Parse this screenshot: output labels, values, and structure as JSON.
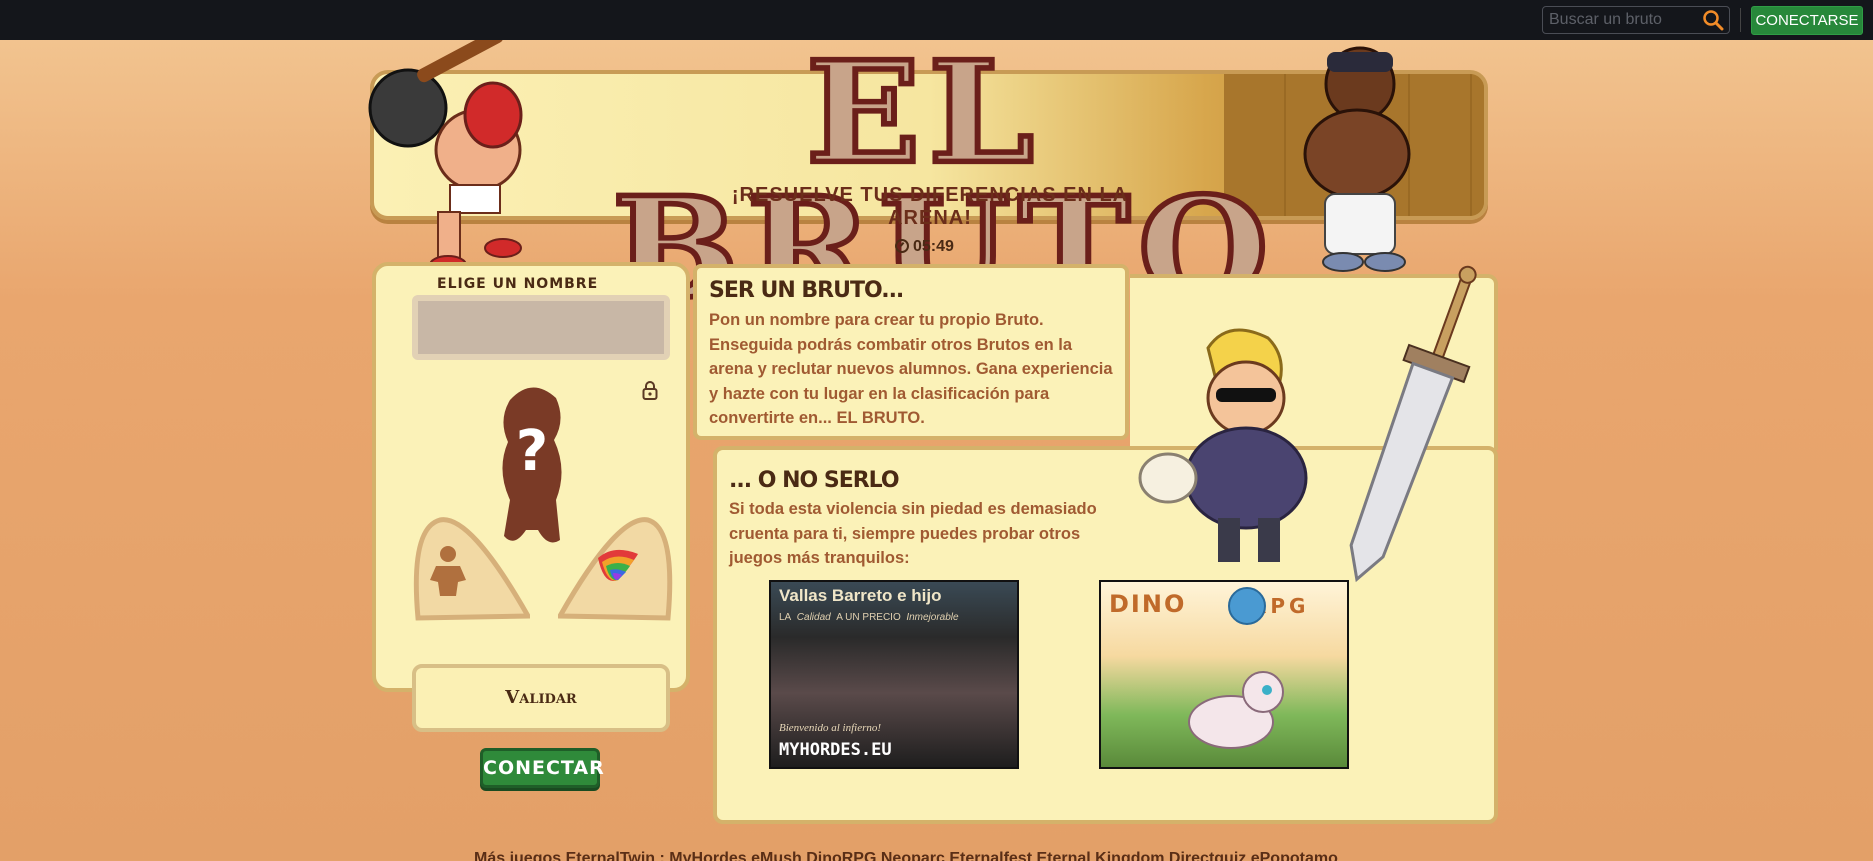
{
  "topbar": {
    "search_placeholder": "Buscar un bruto",
    "connect_label": "CONECTARSE"
  },
  "banner": {
    "logo": "EL BRUTO",
    "subtitle": "¡RESUELVE TUS DIFERENCIAS EN LA ARENA!"
  },
  "clock": "05:49",
  "creator": {
    "name_label": "ELIGE UN NOMBRE",
    "name_value": "",
    "validate_label": "Validar",
    "connect_label": "CONECTAR"
  },
  "ser": {
    "title": "SER UN BRUTO...",
    "text": "Pon un nombre para crear tu propio Bruto. Enseguida podrás combatir otros Brutos en la arena y reclutar nuevos alumnos. Gana experiencia y hazte con tu lugar en la clasificación para convertirte en... EL BRUTO."
  },
  "no": {
    "title": "... O NO SERLO",
    "text": "Si toda esta violencia sin piedad es demasiado cruenta para ti, siempre puedes probar otros juegos más tranquilos:"
  },
  "games": [
    {
      "title": "Vallas Barreto e hijo",
      "tag1": "LA",
      "tag2": "Calidad",
      "tag3": "A UN PRECIO",
      "tag4": "Inmejorable",
      "tagline": "Bienvenido al infierno!",
      "name": "MYHORDES.EU"
    },
    {
      "title": "DINO",
      "title2": "RPG"
    }
  ],
  "footer": "Más juegos EternalTwin : MyHordes eMush DinoRPG Neoparc Eternalfest Eternal Kingdom Directquiz ePopotamo",
  "colors": {
    "topbar": "#14161b",
    "accent_green": "#27883a",
    "panel": "#fbf2b8",
    "panel_border": "#d4b26a",
    "text_brown": "#a05a32"
  },
  "icons": [
    "search-icon",
    "lock-icon",
    "clock-icon",
    "body-type-icon",
    "color-palette-icon"
  ]
}
